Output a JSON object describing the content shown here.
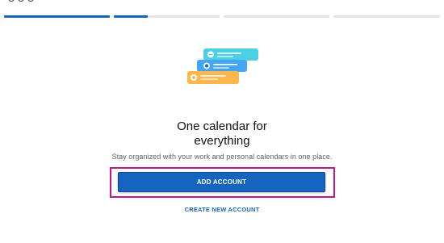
{
  "onboarding": {
    "progress_steps": [
      {
        "label": "step-1",
        "filled": 1.0
      },
      {
        "label": "step-2",
        "filled": 0.32
      },
      {
        "label": "step-3",
        "filled": 0.0
      },
      {
        "label": "step-4",
        "filled": 0.0
      }
    ],
    "illustration_icon": "calendar-cards-icon",
    "title_line1": "One calendar for",
    "title_line2": "everything",
    "subtitle": "Stay organized with your work and personal calendars in one place.",
    "add_account_label": "ADD ACCOUNT",
    "create_account_label": "CREATE NEW ACCOUNT"
  },
  "colors": {
    "accent": "#1565c0",
    "highlight": "#c3158a",
    "card_cyan": "#4dd0e1",
    "card_blue": "#42a5f5",
    "card_orange": "#ffb74d"
  }
}
